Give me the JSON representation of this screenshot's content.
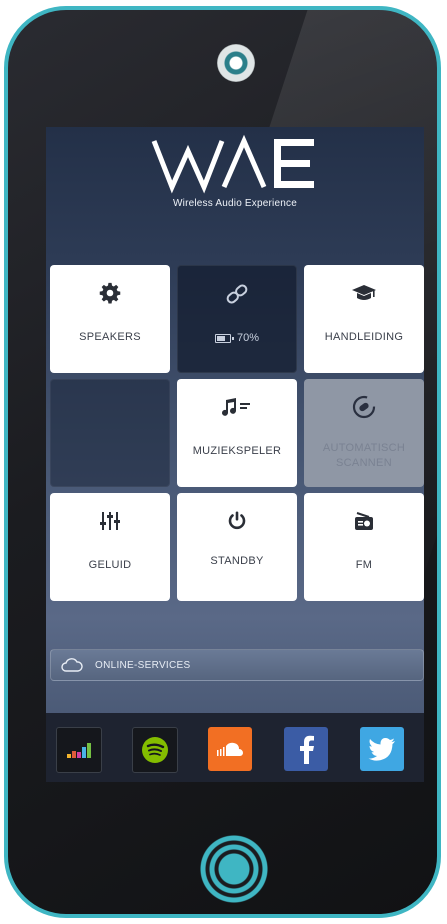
{
  "brand": {
    "logo_text": "WAE",
    "subtitle": "Wireless Audio Experience"
  },
  "tiles": [
    {
      "id": "speakers",
      "label": "SPEAKERS",
      "icon": "gear-icon"
    },
    {
      "id": "battery",
      "label": "70%",
      "icon": "link-icon"
    },
    {
      "id": "manual",
      "label": "HANDLEIDING",
      "icon": "graduation-cap-icon"
    },
    {
      "id": "empty",
      "label": "",
      "icon": ""
    },
    {
      "id": "music-player",
      "label": "MUZIEKSPELER",
      "icon": "music-note-icon"
    },
    {
      "id": "auto-scan",
      "label": "AUTOMATISCH SCANNEN",
      "icon": "scan-icon"
    },
    {
      "id": "sound",
      "label": "GELUID",
      "icon": "sliders-icon"
    },
    {
      "id": "standby",
      "label": "STANDBY",
      "icon": "power-icon"
    },
    {
      "id": "fm",
      "label": "FM",
      "icon": "radio-icon"
    }
  ],
  "battery_level": 0.7,
  "online_services": {
    "label": "ONLINE-SERVICES",
    "icon": "cloud-icon"
  },
  "services": [
    {
      "name": "deezer",
      "icon": "deezer-icon",
      "color": "#1b1d22"
    },
    {
      "name": "spotify",
      "icon": "spotify-icon",
      "color": "#1b1d22"
    },
    {
      "name": "soundcloud",
      "icon": "soundcloud-icon",
      "color": "#f26f23"
    },
    {
      "name": "facebook",
      "icon": "facebook-icon",
      "color": "#3b5ca5"
    },
    {
      "name": "twitter",
      "icon": "twitter-icon",
      "color": "#3fa7e3"
    }
  ],
  "colors": {
    "accent": "#3fb6c3",
    "phone_body": "#1b1c20"
  }
}
